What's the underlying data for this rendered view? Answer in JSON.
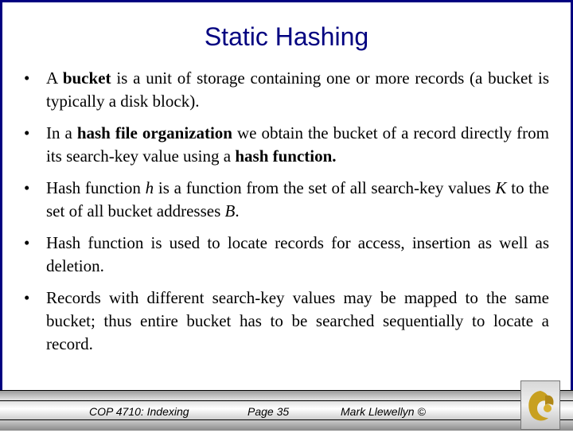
{
  "slide": {
    "title": "Static Hashing",
    "bullets": [
      {
        "html": "A <b>bucket</b> is a unit of storage containing one or more records (a bucket is typically a disk block)."
      },
      {
        "html": "In a <b>hash file organization</b> we obtain the bucket of a record directly from its search-key value using a <b>hash function.</b>"
      },
      {
        "html": "Hash function <i>h</i> is a function from the set of all search-key values <i>K</i> to the set of all bucket addresses <i>B</i>."
      },
      {
        "html": "Hash function is used to locate records for access, insertion as well as deletion."
      },
      {
        "html": "Records with different search-key values may be mapped to the same bucket; thus entire bucket has to be searched sequentially to locate a record."
      }
    ],
    "bullet_glyph": "•"
  },
  "footer": {
    "course": "COP 4710: Indexing",
    "page": "Page 35",
    "author": "Mark Llewellyn ©",
    "logo_icon": "pegasus-logo-icon"
  },
  "colors": {
    "title": "#000080",
    "border": "#000080",
    "logo_gold": "#c8a020"
  }
}
